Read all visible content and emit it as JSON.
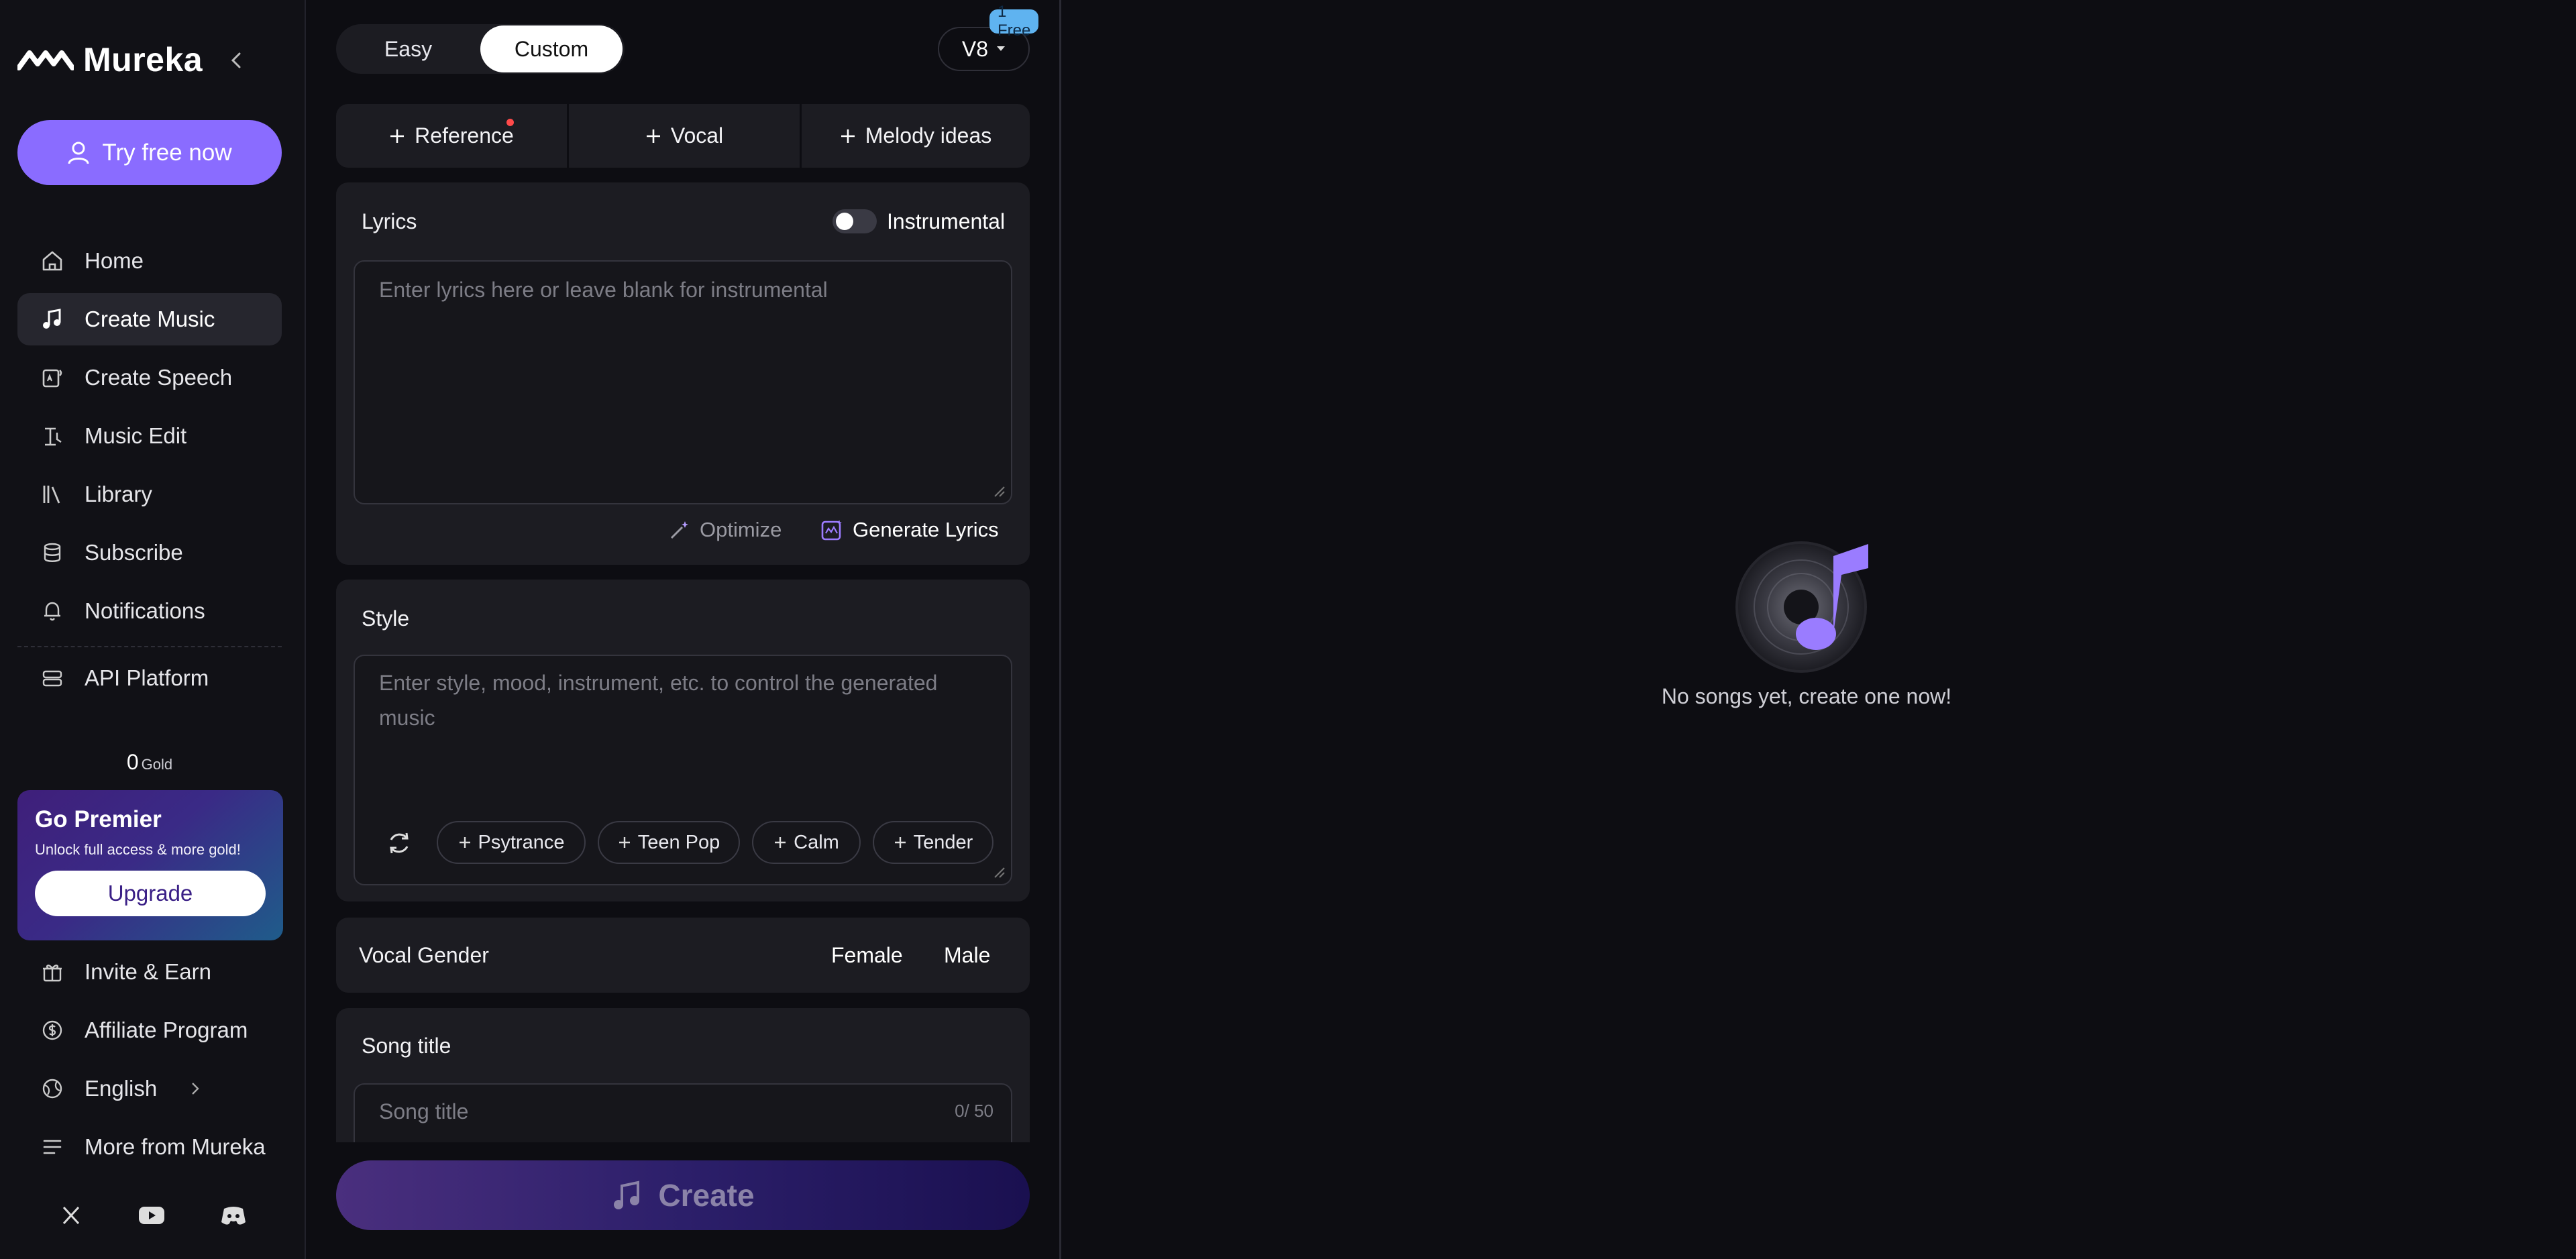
{
  "brand": {
    "name": "Mureka",
    "accent": "#8a6cff"
  },
  "sidebar": {
    "try_button": "Try free now",
    "items": [
      {
        "label": "Home",
        "icon": "home-icon"
      },
      {
        "label": "Create Music",
        "icon": "music-note-icon",
        "active": true
      },
      {
        "label": "Create Speech",
        "icon": "speech-icon"
      },
      {
        "label": "Music Edit",
        "icon": "music-edit-icon"
      },
      {
        "label": "Library",
        "icon": "library-icon"
      },
      {
        "label": "Subscribe",
        "icon": "database-icon"
      },
      {
        "label": "Notifications",
        "icon": "bell-icon"
      },
      {
        "label": "API Platform",
        "icon": "server-icon"
      }
    ],
    "gold_amount": "0",
    "gold_unit": "Gold",
    "premier": {
      "title": "Go Premier",
      "subtitle": "Unlock full access & more gold!",
      "button": "Upgrade"
    },
    "bottom_items": [
      {
        "label": "Invite & Earn",
        "icon": "gift-icon"
      },
      {
        "label": "Affiliate Program",
        "icon": "dollar-circle-icon"
      },
      {
        "label": "English",
        "icon": "globe-icon"
      },
      {
        "label": "More from Mureka",
        "icon": "menu-icon"
      }
    ],
    "socials": [
      "x-icon",
      "youtube-icon",
      "discord-icon"
    ]
  },
  "form": {
    "modes": [
      "Easy",
      "Custom"
    ],
    "selected_mode": "Custom",
    "version": "V8",
    "version_badge": "1 Free",
    "add_tabs": [
      "Reference",
      "Vocal",
      "Melody ideas"
    ],
    "lyrics": {
      "label": "Lyrics",
      "instrumental_label": "Instrumental",
      "instrumental_on": false,
      "placeholder": "Enter lyrics here or leave blank for instrumental",
      "optimize": "Optimize",
      "generate": "Generate Lyrics"
    },
    "style": {
      "label": "Style",
      "placeholder": "Enter style, mood, instrument, etc. to control the generated music",
      "chips": [
        "Psytrance",
        "Teen Pop",
        "Calm",
        "Tender"
      ]
    },
    "vocal_gender": {
      "label": "Vocal Gender",
      "options": [
        "Female",
        "Male"
      ]
    },
    "song_title": {
      "label": "Song title",
      "placeholder": "Song title",
      "counter": "0/ 50"
    },
    "create_button": "Create"
  },
  "empty_state": {
    "message": "No songs yet, create one now!"
  }
}
